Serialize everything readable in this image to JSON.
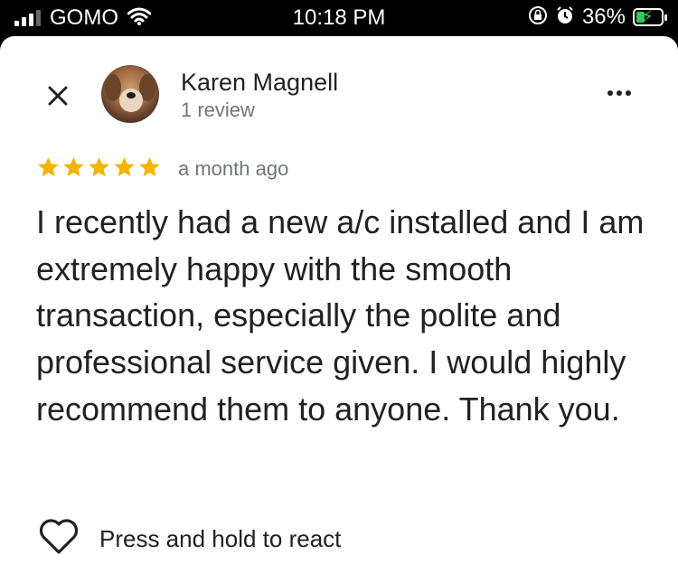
{
  "status_bar": {
    "carrier": "GOMO",
    "time": "10:18 PM",
    "battery_percent": "36%",
    "icons": [
      "signal-icon",
      "wifi-icon",
      "rotation-lock-icon",
      "alarm-icon",
      "battery-charging-icon"
    ],
    "battery_level": 0.36,
    "battery_color": "#34c759"
  },
  "review": {
    "reviewer_name": "Karen Magnell",
    "reviewer_meta": "1 review",
    "rating": 5,
    "rating_max": 5,
    "star_color": "#f4b400",
    "time_ago": "a month ago",
    "text": "I recently had a new a/c installed and I am extremely happy with the smooth transaction, especially the polite and professional service given. I would highly recommend them to anyone. Thank you."
  },
  "actions": {
    "close_icon": "close-icon",
    "more_icon": "more-options-icon",
    "react_icon": "heart-icon",
    "react_label": "Press and hold to react"
  }
}
